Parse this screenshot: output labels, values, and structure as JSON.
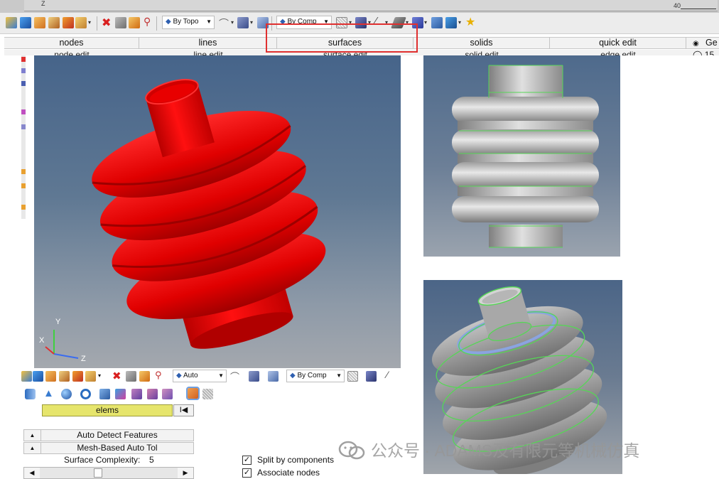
{
  "top_ruler": {
    "label": "40",
    "axis": "Z"
  },
  "toolbar": {
    "topo_select": "By Topo",
    "comp_select": "By Comp",
    "icons": [
      "assembly-icon",
      "component-icon",
      "folder-icon",
      "save-icon",
      "import-icon",
      "delete-icon",
      "hide-icon",
      "show-icon",
      "transform-icon",
      "visualization-icon",
      "curve-icon",
      "plane-icon",
      "solid-icon",
      "wire-icon",
      "mesh-icon",
      "line-icon",
      "shade-icon",
      "layer-icon",
      "display-icon",
      "star-icon"
    ]
  },
  "tabs": {
    "row1": [
      "nodes",
      "lines",
      "surfaces",
      "solids",
      "quick edit"
    ],
    "row2": [
      "node edit",
      "line edit",
      "surface edit",
      "solid edit",
      "edge edit"
    ]
  },
  "right_panel": {
    "radio1": "Ge",
    "radio2": "15"
  },
  "main_view": {
    "axes": {
      "x": "X",
      "y": "Y",
      "z": "Z"
    },
    "part_color": "#ee0000"
  },
  "bottom_panel": {
    "topo_select": "Auto",
    "comp_select": "By Comp",
    "elems_label": "elems",
    "elems_reset": "I◀",
    "option1": "Auto Detect Features",
    "option2": "Mesh-Based Auto Tol",
    "complexity_label": "Surface Complexity:",
    "complexity_value": "5",
    "split_label": "Split by components",
    "associate_label": "Associate nodes",
    "split_checked": true,
    "associate_checked": true
  },
  "watermark": {
    "text": "公众号 · ADAMS及有限元等机械仿真"
  },
  "colors": {
    "highlight": "#e03030",
    "elems_field": "#e6e56c",
    "edge_green": "#56d656"
  }
}
